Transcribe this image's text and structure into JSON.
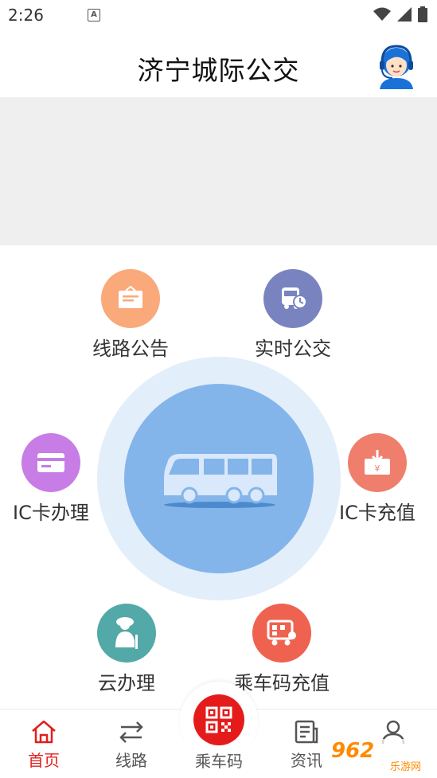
{
  "status": {
    "time": "2:26",
    "notif": "A"
  },
  "header": {
    "title": "济宁城际公交"
  },
  "features": {
    "route_notice": "线路公告",
    "realtime_bus": "实时公交",
    "ic_card_service": "IC卡办理",
    "ic_card_recharge": "IC卡充值",
    "cloud_service": "云办理",
    "ride_code_recharge": "乘车码充值"
  },
  "tabs": {
    "home": "首页",
    "routes": "线路",
    "ride_code": "乘车码",
    "news": "资讯",
    "mine": ""
  },
  "watermark": {
    "text": "962",
    "sub": "乐游网"
  },
  "colors": {
    "accent_red": "#e0201c",
    "center_blue": "#84b5ea",
    "ring_blue": "#e3eefb",
    "orange": "#f9a97a",
    "indigo": "#7883c0",
    "purple": "#c77de5",
    "salmon": "#f07e6c",
    "teal": "#53a9a8",
    "coral": "#ef6250"
  }
}
